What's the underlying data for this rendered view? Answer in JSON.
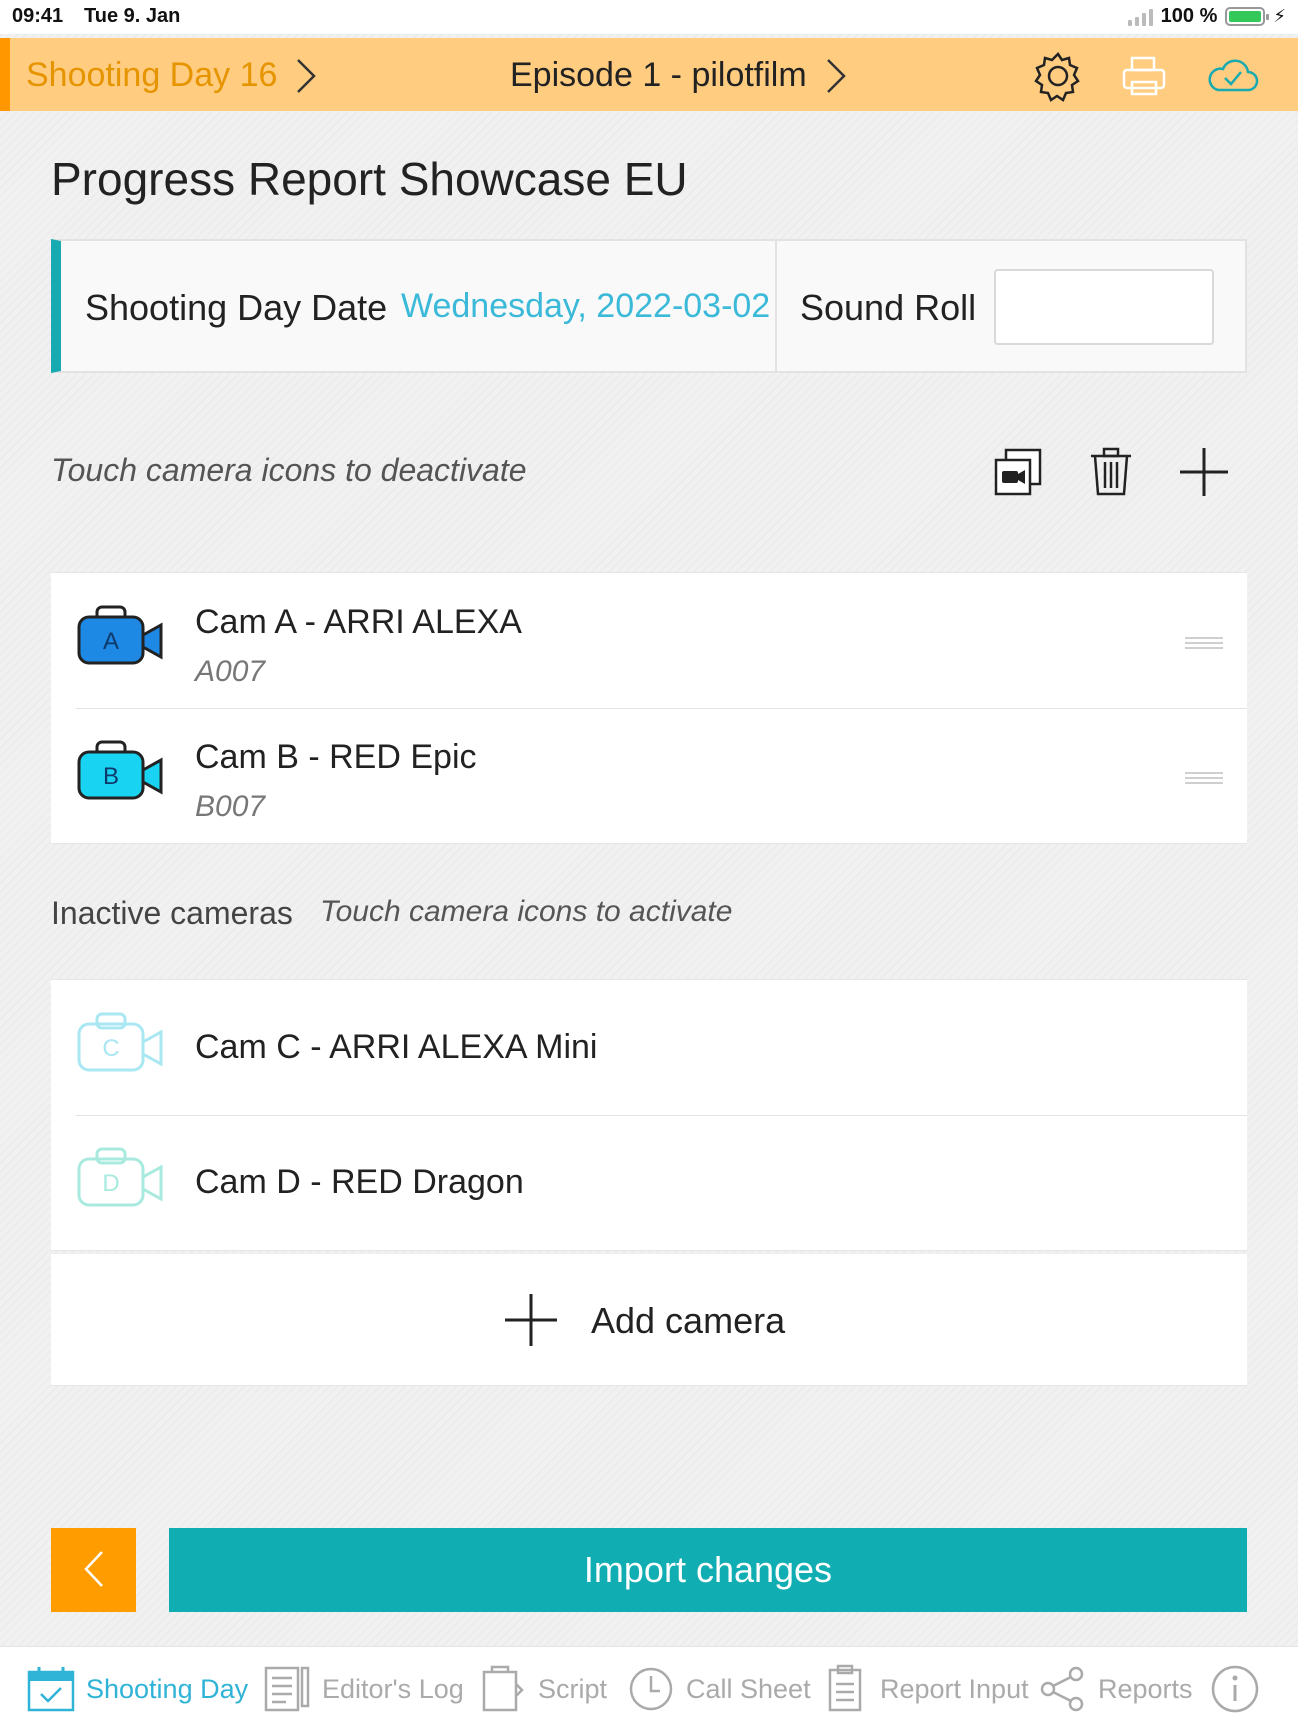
{
  "status": {
    "time": "09:41",
    "date": "Tue 9. Jan",
    "battery": "100 %"
  },
  "header": {
    "shooting_day": "Shooting Day 16",
    "episode": "Episode 1 - pilotfilm",
    "colors": {
      "bar": "#ffcc80",
      "accent": "#ff9800"
    },
    "icons": [
      "gear-icon",
      "printer-icon",
      "cloud-check-icon"
    ]
  },
  "page": {
    "title": "Progress Report Showcase EU"
  },
  "date_card": {
    "label": "Shooting Day Date",
    "value": "Wednesday, 2022-03-02",
    "sound_roll_label": "Sound Roll",
    "sound_roll_value": ""
  },
  "active": {
    "hint": "Touch camera icons to deactivate",
    "tools": [
      "copy-camera-icon",
      "trash-icon",
      "plus-icon"
    ],
    "cameras": [
      {
        "letter": "A",
        "name": "Cam A - ARRI ALEXA",
        "roll": "A007",
        "color": "#1e88e5"
      },
      {
        "letter": "B",
        "name": "Cam B - RED Epic",
        "roll": "B007",
        "color": "#18d4f2"
      }
    ]
  },
  "inactive": {
    "label": "Inactive cameras",
    "hint": "Touch camera icons to activate",
    "cameras": [
      {
        "letter": "C",
        "name": "Cam C - ARRI ALEXA Mini",
        "color": "#a9e7f2"
      },
      {
        "letter": "D",
        "name": "Cam D - RED Dragon",
        "color": "#a9eadf"
      }
    ]
  },
  "add_camera": {
    "label": "Add camera"
  },
  "actions": {
    "import_label": "Import changes"
  },
  "tabs": [
    {
      "label": "Shooting Day",
      "icon": "calendar-check-icon",
      "active": true
    },
    {
      "label": "Editor's Log",
      "icon": "notepad-icon",
      "active": false
    },
    {
      "label": "Script",
      "icon": "script-icon",
      "active": false
    },
    {
      "label": "Call Sheet",
      "icon": "clock-icon",
      "active": false
    },
    {
      "label": "Report Input",
      "icon": "clipboard-icon",
      "active": false
    },
    {
      "label": "Reports",
      "icon": "share-icon",
      "active": false
    },
    {
      "label": "",
      "icon": "info-icon",
      "active": false
    }
  ]
}
